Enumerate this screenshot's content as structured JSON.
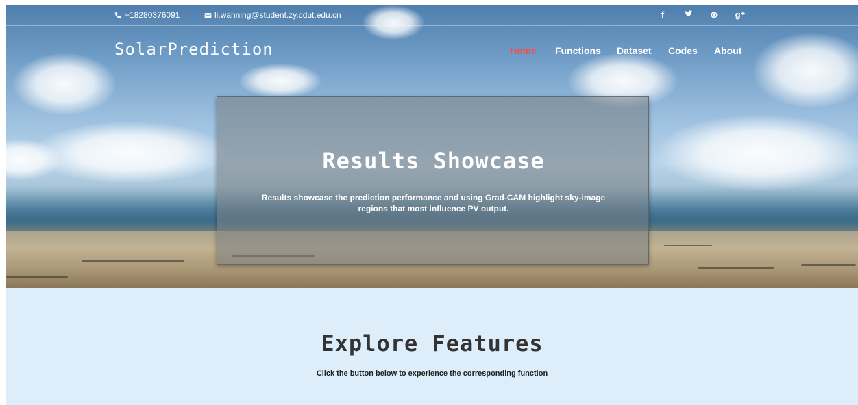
{
  "topbar": {
    "phone": "+18280376091",
    "email": "li.wanning@student.zy.cdut.edu.cn",
    "social": [
      {
        "icon": "facebook-icon",
        "glyph": "f"
      },
      {
        "icon": "twitter-icon",
        "glyph": "🐦"
      },
      {
        "icon": "dribbble-icon",
        "glyph": "⊛"
      },
      {
        "icon": "google-plus-icon",
        "glyph": "g⁺"
      }
    ]
  },
  "brand": "SolarPrediction",
  "nav": [
    {
      "label": "Home",
      "active": true
    },
    {
      "label": "Functions",
      "active": false
    },
    {
      "label": "Dataset",
      "active": false
    },
    {
      "label": "Codes",
      "active": false
    },
    {
      "label": "About",
      "active": false
    }
  ],
  "showcase": {
    "title": "Results Showcase",
    "description": "Results showcase the prediction performance and using Grad-CAM highlight sky-image regions that most influence PV output."
  },
  "explore": {
    "title": "Explore Features",
    "subtitle": "Click the button below to experience the corresponding function"
  },
  "colors": {
    "nav_active": "#ff4a4a",
    "explore_bg": "#ddedf9"
  }
}
